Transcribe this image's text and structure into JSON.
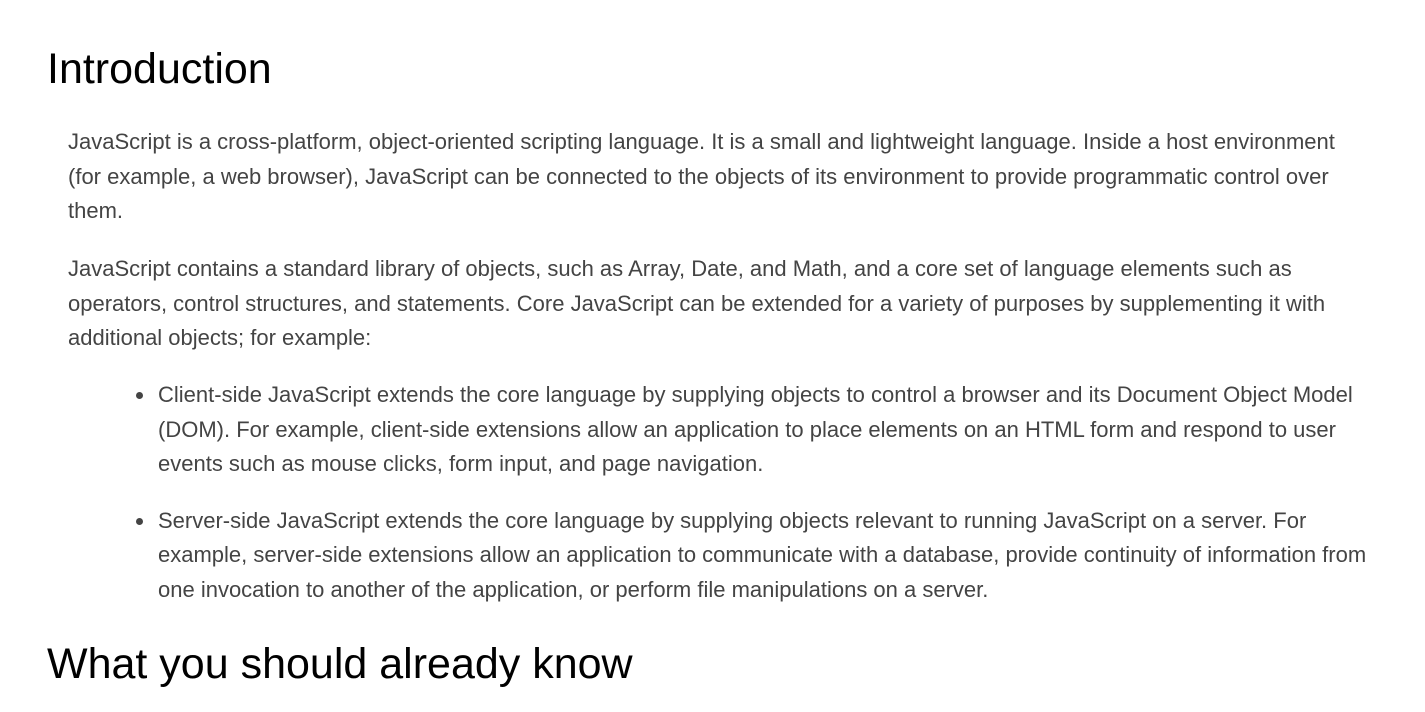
{
  "sections": {
    "introduction": {
      "heading": "Introduction",
      "paragraphs": [
        "JavaScript is a cross-platform, object-oriented scripting language. It is a small and lightweight language. Inside a host environment (for example, a web browser), JavaScript can be connected to the objects of its environment to provide programmatic control over them.",
        "JavaScript contains a standard library of objects, such as Array, Date, and Math, and a core set of language elements such as operators, control structures, and statements. Core JavaScript can be extended for a variety of purposes by supplementing it with additional objects; for example:"
      ],
      "list_items": [
        "Client-side JavaScript extends the core language by supplying objects to control a browser and its Document Object Model (DOM). For example, client-side extensions allow an application to place elements on an HTML form and respond to user events such as mouse clicks, form input, and page navigation.",
        "Server-side JavaScript extends the core language by supplying objects relevant to running JavaScript on a server. For example, server-side extensions allow an application to communicate with a database, provide continuity of information from one invocation to another of the application, or perform file manipulations on a server."
      ]
    },
    "prerequisites": {
      "heading": "What you should already know"
    }
  },
  "colors": {
    "heading": "#000000",
    "body_text": "#444444",
    "background": "#ffffff"
  }
}
